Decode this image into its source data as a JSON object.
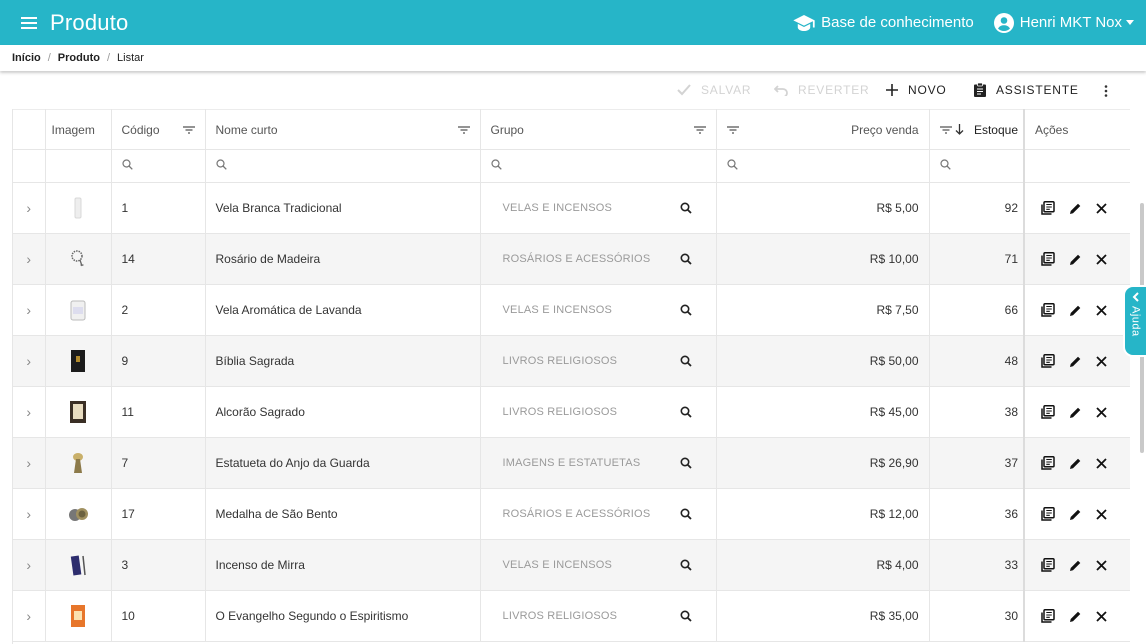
{
  "app": {
    "title": "Produto"
  },
  "header": {
    "knowledge_base": "Base de conhecimento",
    "user": "Henri MKT Nox"
  },
  "breadcrumb": [
    "Início",
    "Produto",
    "Listar"
  ],
  "toolbar": {
    "save": "SALVAR",
    "revert": "REVERTER",
    "new": "NOVO",
    "assistant": "ASSISTENTE"
  },
  "columns": {
    "image": "Imagem",
    "code": "Código",
    "name": "Nome curto",
    "group": "Grupo",
    "price": "Preço venda",
    "stock": "Estoque",
    "actions": "Ações"
  },
  "rows": [
    {
      "code": "1",
      "name": "Vela Branca Tradicional",
      "group": "VELAS E INCENSOS",
      "price": "R$ 5,00",
      "stock": "92",
      "thumb": "candle-white"
    },
    {
      "code": "14",
      "name": "Rosário de Madeira",
      "group": "ROSÁRIOS E ACESSÓRIOS",
      "price": "R$ 10,00",
      "stock": "71",
      "thumb": "rosary"
    },
    {
      "code": "2",
      "name": "Vela Aromática de Lavanda",
      "group": "VELAS E INCENSOS",
      "price": "R$ 7,50",
      "stock": "66",
      "thumb": "candle-jar"
    },
    {
      "code": "9",
      "name": "Bíblia Sagrada",
      "group": "LIVROS RELIGIOSOS",
      "price": "R$ 50,00",
      "stock": "48",
      "thumb": "book-black"
    },
    {
      "code": "11",
      "name": "Alcorão Sagrado",
      "group": "LIVROS RELIGIOSOS",
      "price": "R$ 45,00",
      "stock": "38",
      "thumb": "book-frame"
    },
    {
      "code": "7",
      "name": "Estatueta do Anjo da Guarda",
      "group": "IMAGENS E ESTATUETAS",
      "price": "R$ 26,90",
      "stock": "37",
      "thumb": "statue"
    },
    {
      "code": "17",
      "name": "Medalha de São Bento",
      "group": "ROSÁRIOS E ACESSÓRIOS",
      "price": "R$ 12,00",
      "stock": "36",
      "thumb": "medal"
    },
    {
      "code": "3",
      "name": "Incenso de Mirra",
      "group": "VELAS E INCENSOS",
      "price": "R$ 4,00",
      "stock": "33",
      "thumb": "incense"
    },
    {
      "code": "10",
      "name": "O Evangelho Segundo o Espiritismo",
      "group": "LIVROS RELIGIOSOS",
      "price": "R$ 35,00",
      "stock": "30",
      "thumb": "book-orange"
    }
  ],
  "help": {
    "label": "Ajuda"
  },
  "colors": {
    "primary": "#26b5c8"
  }
}
